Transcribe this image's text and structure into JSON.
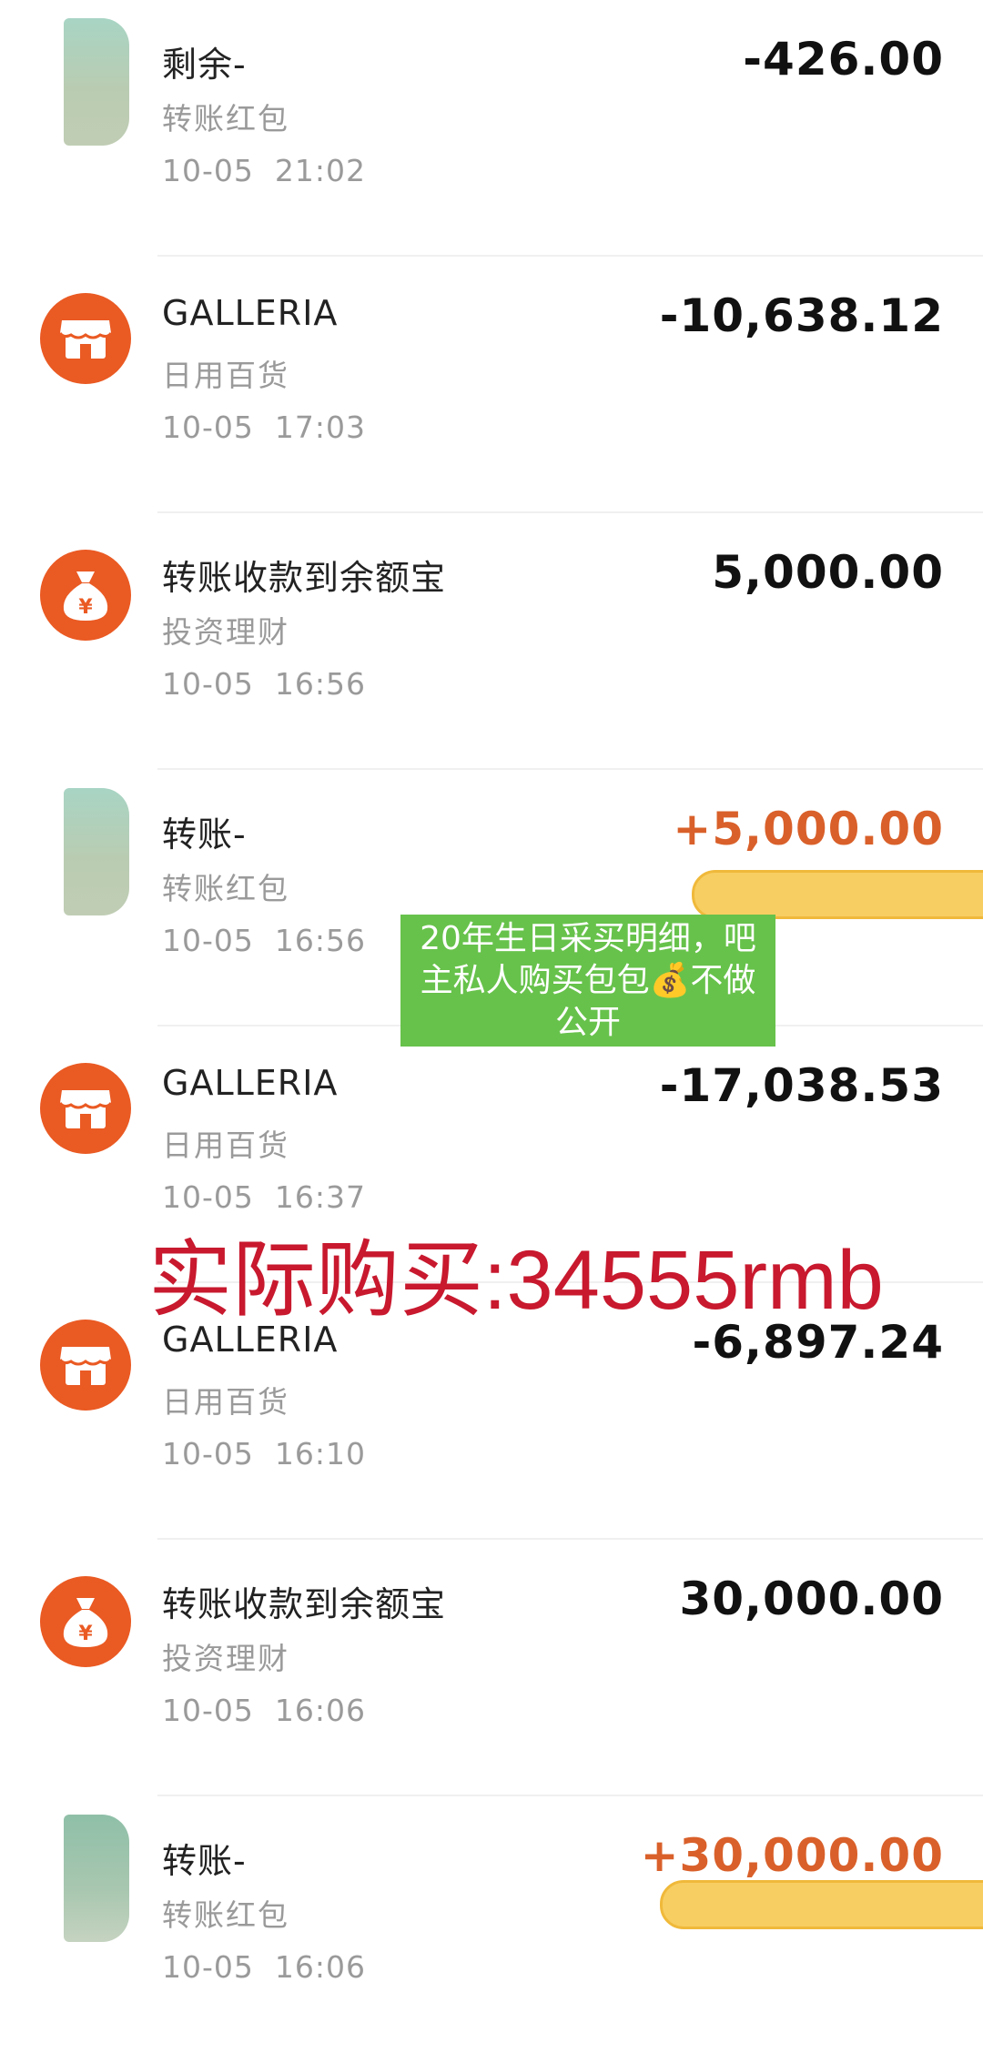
{
  "transactions": [
    {
      "icon": "avatar",
      "title": "剩余-",
      "category": "转账红包",
      "time": "10-05  21:02",
      "amount": "-426.00",
      "positive": false
    },
    {
      "icon": "shop-icon",
      "title": "GALLERIA",
      "category": "日用百货",
      "time": "10-05  17:03",
      "amount": "-10,638.12",
      "positive": false
    },
    {
      "icon": "money-bag-icon",
      "title": "转账收款到余额宝",
      "category": "投资理财",
      "time": "10-05  16:56",
      "amount": "5,000.00",
      "positive": false
    },
    {
      "icon": "avatar",
      "title": "转账-",
      "category": "转账红包",
      "time": "10-05  16:56",
      "amount": "+5,000.00",
      "positive": true
    },
    {
      "icon": "shop-icon",
      "title": "GALLERIA",
      "category": "日用百货",
      "time": "10-05  16:37",
      "amount": "-17,038.53",
      "positive": false
    },
    {
      "icon": "shop-icon",
      "title": "GALLERIA",
      "category": "日用百货",
      "time": "10-05  16:10",
      "amount": "-6,897.24",
      "positive": false
    },
    {
      "icon": "money-bag-icon",
      "title": "转账收款到余额宝",
      "category": "投资理财",
      "time": "10-05  16:06",
      "amount": "30,000.00",
      "positive": false
    },
    {
      "icon": "avatar",
      "title": "转账-",
      "category": "转账红包",
      "time": "10-05  16:06",
      "amount": "+30,000.00",
      "positive": true
    }
  ],
  "annotations": {
    "green_note_lines": [
      "20年生日采买明细，吧",
      "主私人购买包包💰不做",
      "公开"
    ],
    "red_note": "实际购买:34555rmb"
  },
  "colors": {
    "icon_orange": "#ea5a23",
    "positive_amount": "#d9602a",
    "note_green": "#67c24b",
    "note_red": "#c8192e",
    "highlight_yellow": "#f7ce62"
  }
}
